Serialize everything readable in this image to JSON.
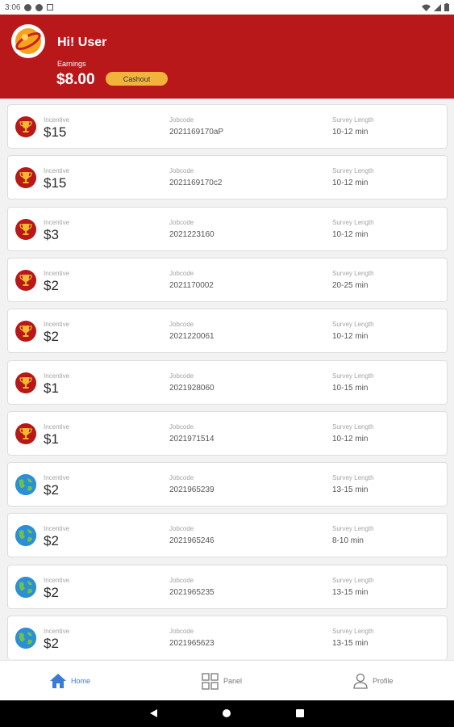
{
  "status": {
    "time": "3:06"
  },
  "header": {
    "greeting": "Hi! User",
    "earnings_label": "Earnings",
    "earnings_value": "$8.00",
    "cashout_label": "Cashout"
  },
  "columns": {
    "incentive": "Incentive",
    "jobcode": "Jobcode",
    "length": "Survey Length"
  },
  "surveys": [
    {
      "icon": "trophy-icon",
      "incentive": "$15",
      "jobcode": "2021169170aP",
      "length": "10-12 min"
    },
    {
      "icon": "trophy-icon",
      "incentive": "$15",
      "jobcode": "2021169170c2",
      "length": "10-12 min"
    },
    {
      "icon": "trophy-icon",
      "incentive": "$3",
      "jobcode": "2021223160",
      "length": "10-12 min"
    },
    {
      "icon": "trophy-icon",
      "incentive": "$2",
      "jobcode": "2021170002",
      "length": "20-25 min"
    },
    {
      "icon": "trophy-icon",
      "incentive": "$2",
      "jobcode": "2021220061",
      "length": "10-12 min"
    },
    {
      "icon": "trophy-icon",
      "incentive": "$1",
      "jobcode": "2021928060",
      "length": "10-15 min"
    },
    {
      "icon": "trophy-icon",
      "incentive": "$1",
      "jobcode": "2021971514",
      "length": "10-12 min"
    },
    {
      "icon": "globe-icon",
      "incentive": "$2",
      "jobcode": "2021965239",
      "length": "13-15 min"
    },
    {
      "icon": "globe-icon",
      "incentive": "$2",
      "jobcode": "2021965246",
      "length": "8-10 min"
    },
    {
      "icon": "globe-icon",
      "incentive": "$2",
      "jobcode": "2021965235",
      "length": "13-15 min"
    },
    {
      "icon": "globe-icon",
      "incentive": "$2",
      "jobcode": "2021965623",
      "length": "13-15 min"
    }
  ],
  "nav": {
    "home": "Home",
    "panel": "Panel",
    "profile": "Profile"
  },
  "colors": {
    "brand_red": "#b9181a",
    "cashout_yellow": "#f2b33d",
    "active_blue": "#3a7bd5"
  }
}
